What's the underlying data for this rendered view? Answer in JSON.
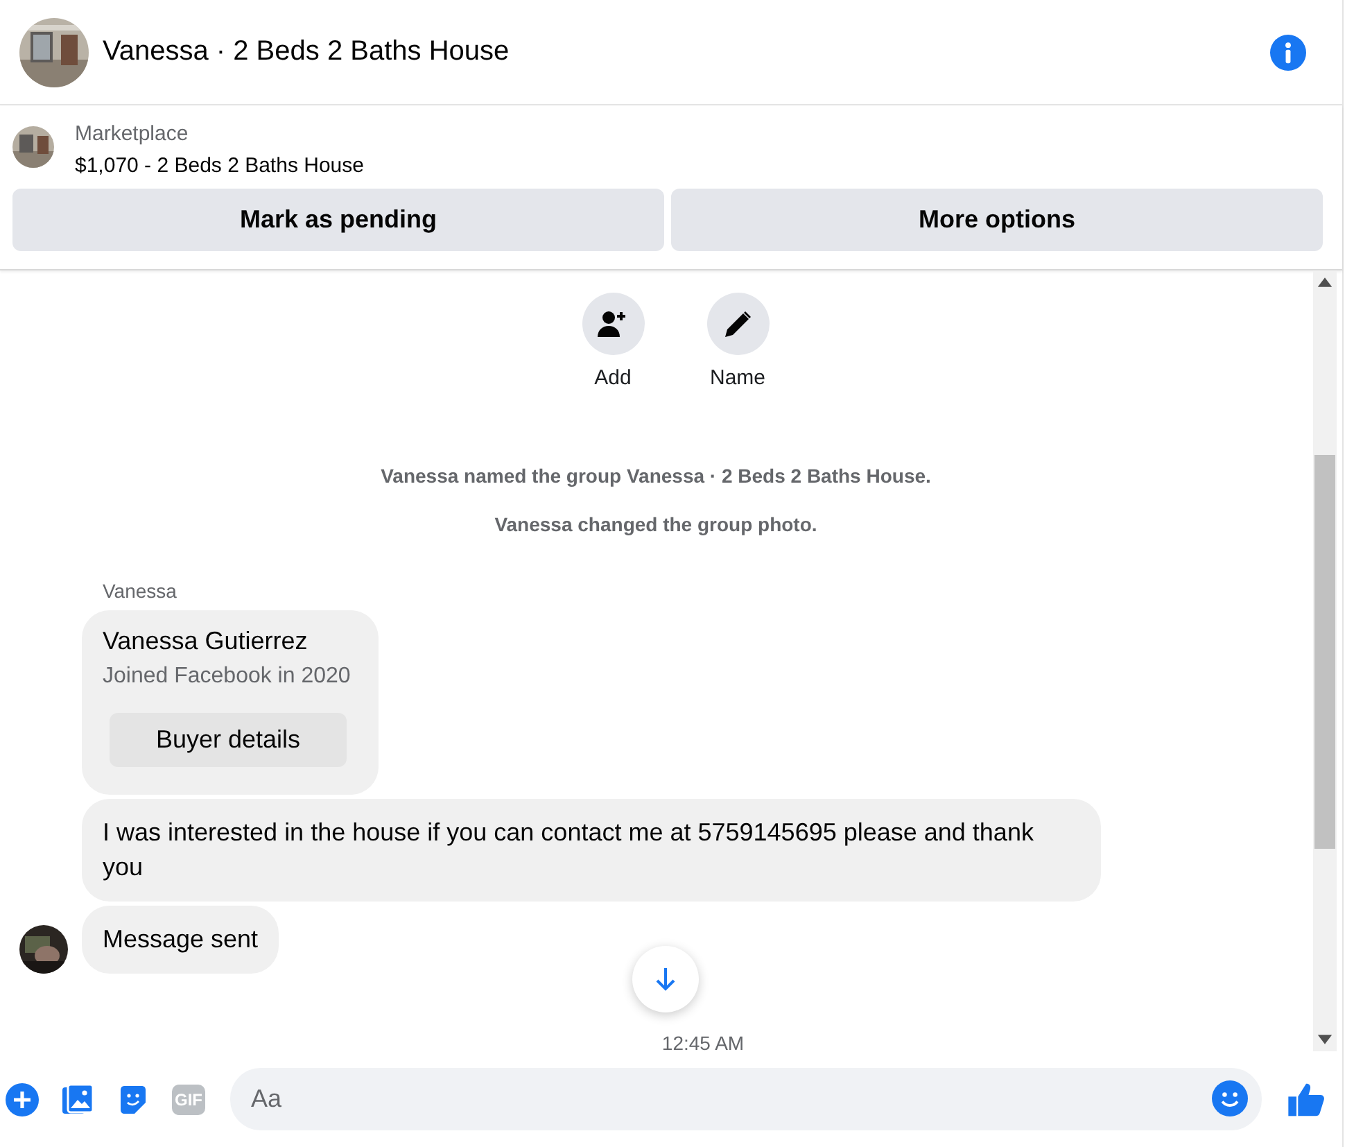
{
  "header": {
    "title": "Vanessa · 2 Beds 2 Baths House"
  },
  "listing": {
    "source": "Marketplace",
    "title": "$1,070 - 2 Beds 2 Baths House"
  },
  "listing_buttons": [
    "Mark as pending",
    "More options"
  ],
  "actions": [
    {
      "kind": "add",
      "label": "Add"
    },
    {
      "kind": "name",
      "label": "Name"
    }
  ],
  "events": [
    "Vanessa named the group Vanessa · 2 Beds 2 Baths House.",
    "Vanessa changed the group photo."
  ],
  "sender": "Vanessa",
  "profile_card": {
    "name": "Vanessa Gutierrez",
    "subtitle": "Joined Facebook in 2020",
    "button": "Buyer details"
  },
  "messages": [
    {
      "text": "I was interested in the house if you can contact me at 5759145695 please and thank you",
      "avatar": false
    },
    {
      "text": "Message sent",
      "avatar": true
    }
  ],
  "timestamp": "12:45 AM",
  "composer": {
    "gif": "GIF",
    "placeholder": "Aa"
  }
}
